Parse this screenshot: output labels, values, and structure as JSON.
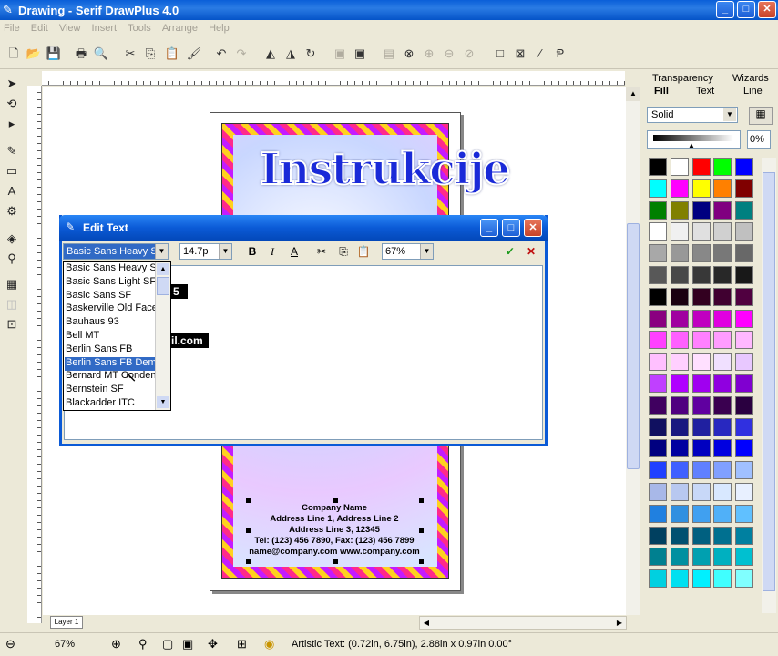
{
  "window": {
    "title": "Drawing - Serif DrawPlus 4.0"
  },
  "menu": [
    "File",
    "Edit",
    "View",
    "Insert",
    "Tools",
    "Arrange",
    "Help"
  ],
  "canvas": {
    "headline": "Instrukcije",
    "snippet_top": "5",
    "snippet_mid": "il.com",
    "address_lines": [
      "Company Name",
      "Address Line 1, Address Line 2",
      "Address Line 3, 12345",
      "Tel: (123) 456 7890, Fax: (123) 456 7899",
      "name@company.com  www.company.com"
    ],
    "layer_tab": "Layer 1"
  },
  "panel": {
    "tabs_top": [
      "Transparency",
      "Wizards"
    ],
    "tabs_bottom": [
      "Fill",
      "Text",
      "Line"
    ],
    "fill_type": "Solid",
    "opacity": "0%",
    "swatch_colors": [
      "#000000",
      "#ffffff",
      "#ff0000",
      "#00ff00",
      "#0000ff",
      "#00ffff",
      "#ff00ff",
      "#ffff00",
      "#ff8000",
      "#800000",
      "#008000",
      "#808000",
      "#000080",
      "#800080",
      "#008080",
      "#ffffff",
      "#f0f0f0",
      "#e0e0e0",
      "#d0d0d0",
      "#c0c0c0",
      "#a8a8a8",
      "#989898",
      "#888888",
      "#787878",
      "#686868",
      "#585858",
      "#484848",
      "#383838",
      "#282828",
      "#181818",
      "#000000",
      "#1a0010",
      "#330020",
      "#400030",
      "#500040",
      "#8a0080",
      "#a000a0",
      "#c000c0",
      "#e000e0",
      "#ff00ff",
      "#ff40ff",
      "#ff60ff",
      "#ff80ff",
      "#ff9cff",
      "#ffb8ff",
      "#ffc0ff",
      "#ffd0ff",
      "#ffe0ff",
      "#f0e0ff",
      "#e8c8ff",
      "#c040ff",
      "#b000ff",
      "#a000f0",
      "#9000e0",
      "#8000d0",
      "#400060",
      "#500080",
      "#6000a0",
      "#3a0050",
      "#2a0040",
      "#101060",
      "#181880",
      "#2020a0",
      "#2828c0",
      "#3030e0",
      "#000080",
      "#0000a0",
      "#0000c0",
      "#0000e0",
      "#0000ff",
      "#2040ff",
      "#4060ff",
      "#6080ff",
      "#80a0ff",
      "#a0c0ff",
      "#a8b8e8",
      "#b8c8f0",
      "#c8d8f8",
      "#d8e8ff",
      "#e8f0ff",
      "#2080e0",
      "#3090e0",
      "#40a0f0",
      "#50b0f8",
      "#60c0ff",
      "#004060",
      "#005070",
      "#006080",
      "#007090",
      "#0080a0",
      "#008090",
      "#0090a0",
      "#00a0b0",
      "#00b0c0",
      "#00c0d0",
      "#00d0e0",
      "#00e0f0",
      "#00f0ff",
      "#40ffff",
      "#80ffff"
    ]
  },
  "dialog": {
    "title": "Edit Text",
    "font": "Basic Sans Heavy SF",
    "size": "14.7p",
    "zoom": "67%",
    "fonts": [
      "Basic Sans Heavy SF",
      "Basic Sans Light SF",
      "Basic Sans SF",
      "Baskerville Old Face",
      "Bauhaus 93",
      "Bell MT",
      "Berlin Sans FB",
      "Berlin Sans FB Demi",
      "Bernard MT Condensed",
      "Bernstein SF",
      "Blackadder ITC"
    ],
    "selected_font": "Berlin Sans FB Demi"
  },
  "status": {
    "zoom": "67%",
    "message": "Artistic Text: (0.72in, 6.75in), 2.88in x 0.97in 0.00°"
  }
}
